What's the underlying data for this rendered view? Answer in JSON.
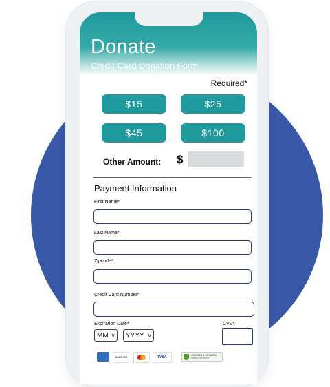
{
  "form": {
    "title": "Donate",
    "subtitle": "Credit Card Donation Form",
    "required_note": "Required*",
    "amounts": [
      "$15",
      "$25",
      "$45",
      "$100"
    ],
    "other_amount_label": "Other Amount:",
    "currency_symbol": "$"
  },
  "payment": {
    "section_title": "Payment Information",
    "first_name_label": "First Name*",
    "last_name_label": "Last Name*",
    "zipcode_label": "Zipcode*",
    "card_number_label": "Credit Card Number*",
    "expiration_label": "Expiration Date*",
    "cvv_label": "CVV*",
    "month_select": "MM",
    "year_select": "YYYY"
  },
  "badges": {
    "discover": "DISCOVER",
    "visa": "VISA",
    "secure_line1": "VERIFIED & SECURED",
    "secure_line2": "VERIFY SECURITY"
  },
  "colors": {
    "accent": "#1f9a9c",
    "circle": "#3a58a8",
    "field_border": "#2b3a8c"
  }
}
